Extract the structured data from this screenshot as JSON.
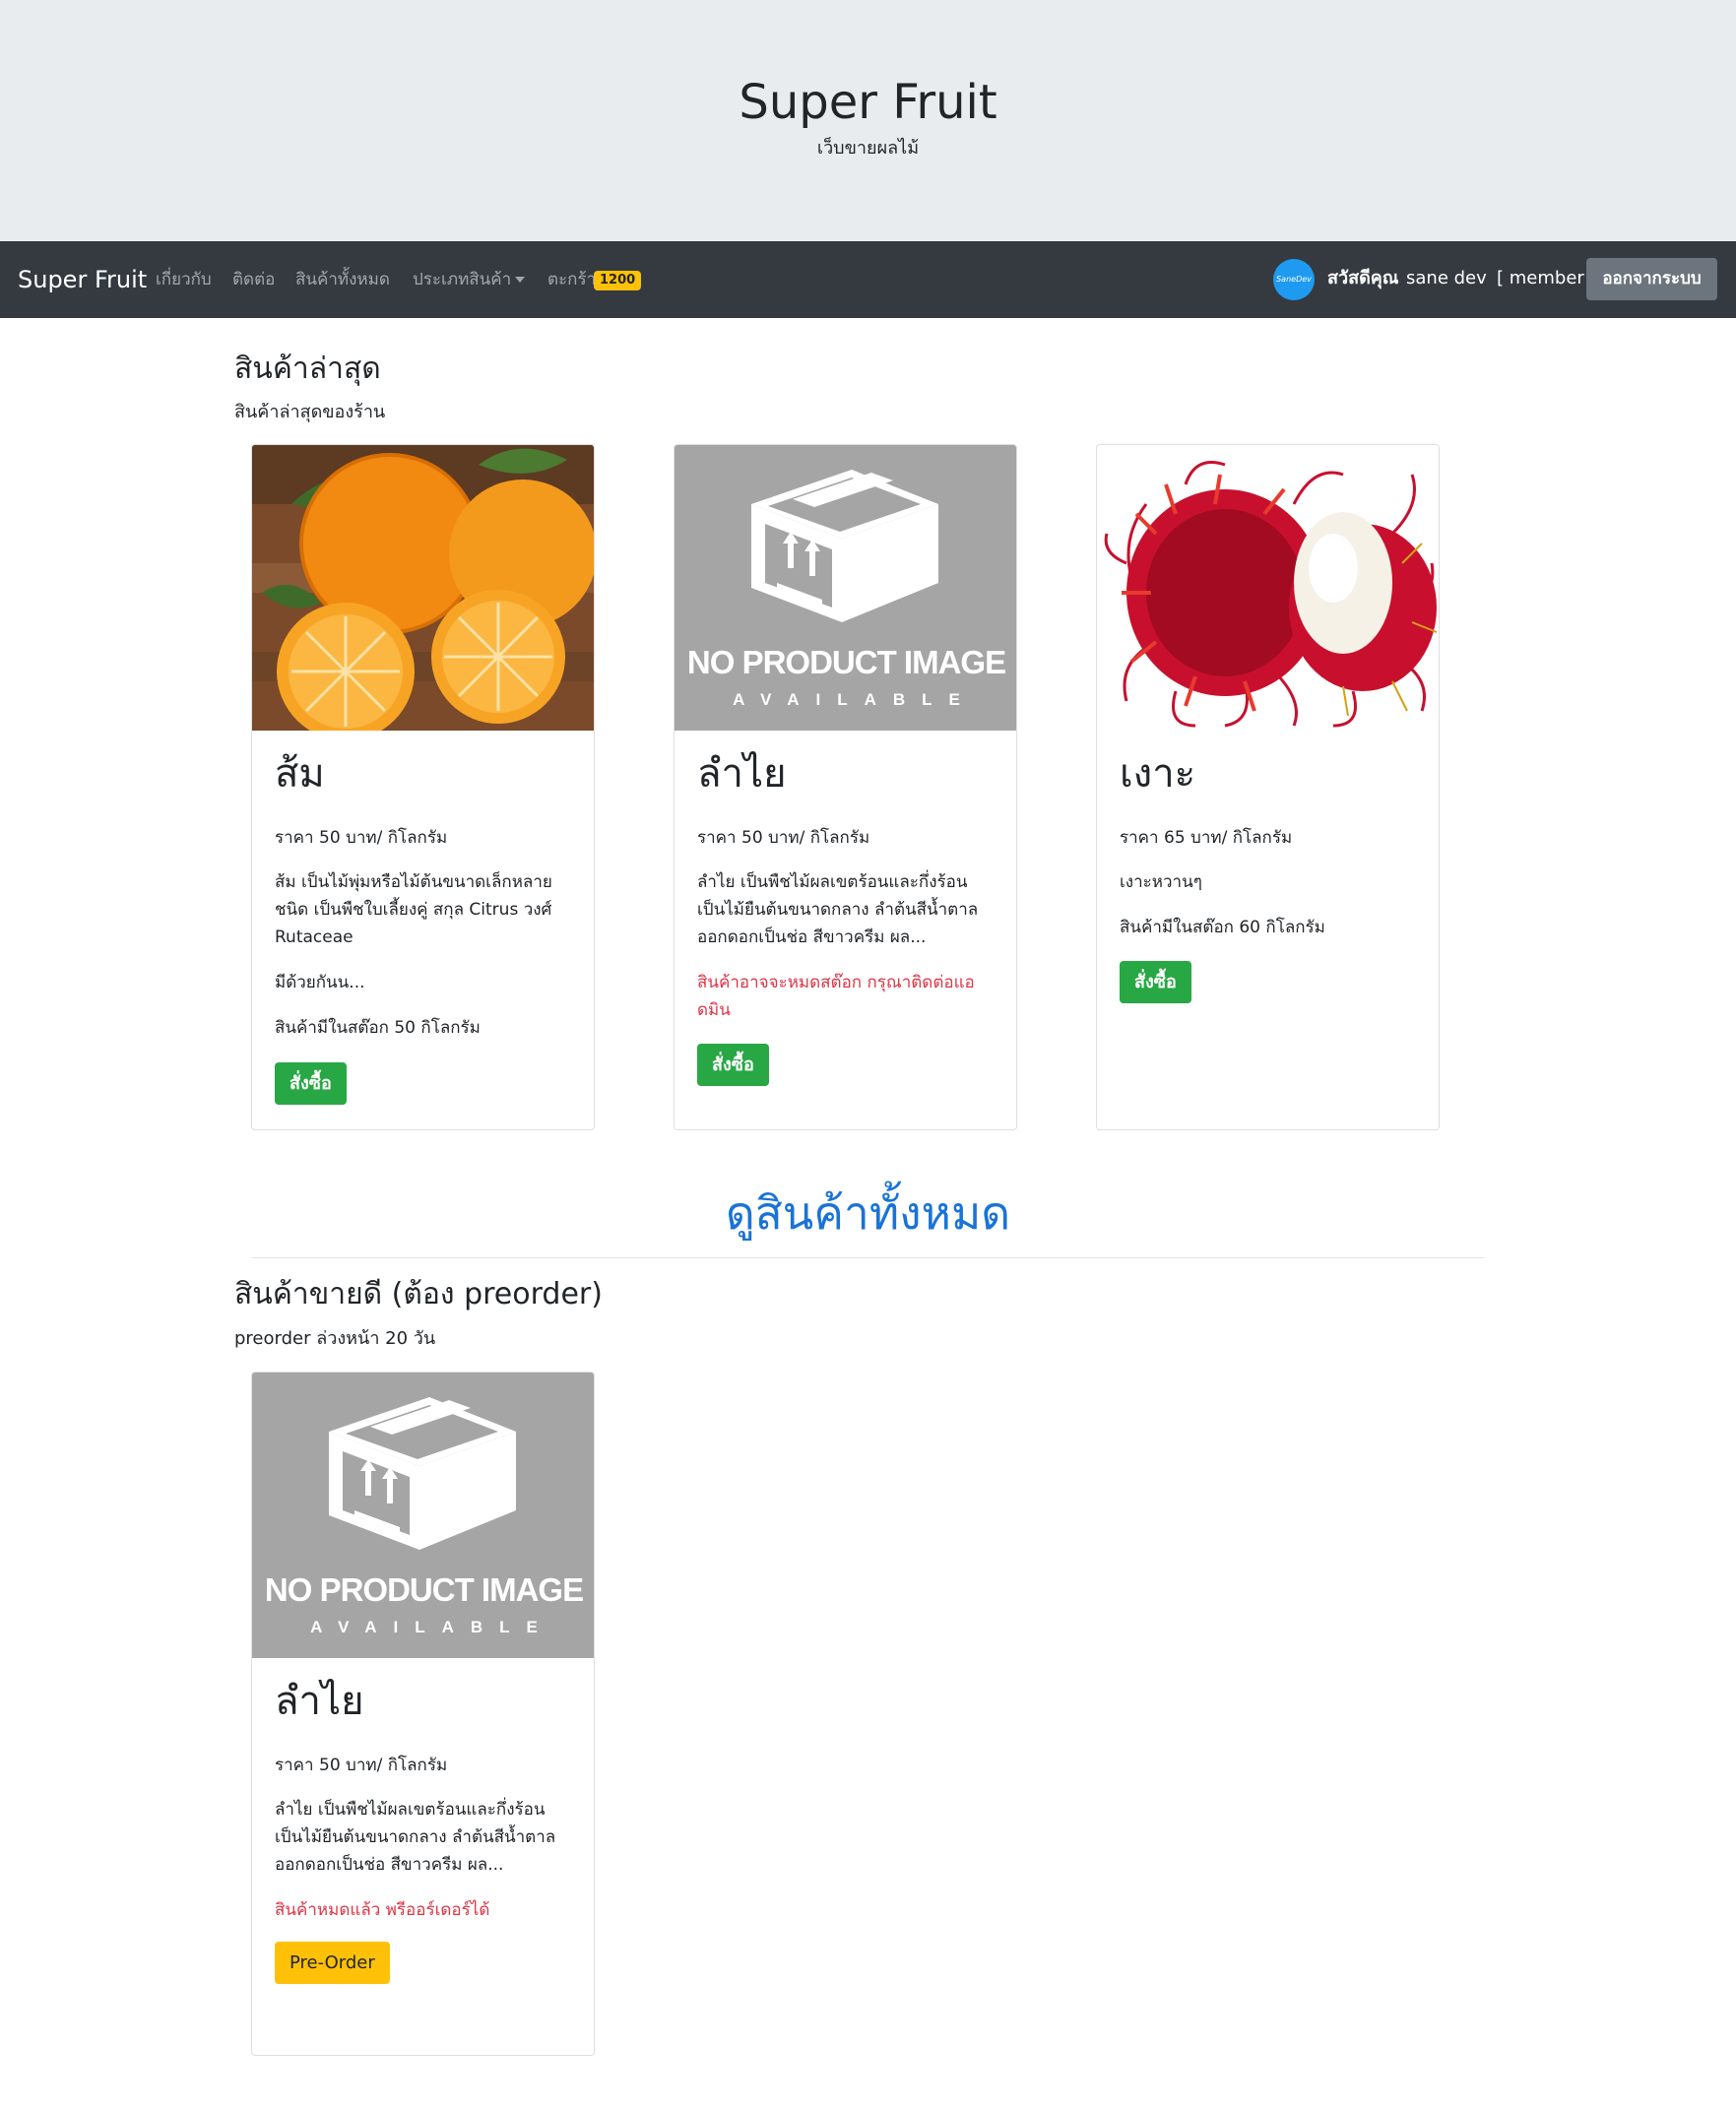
{
  "header": {
    "title": "Super Fruit",
    "subtitle": "เว็บขายผลไม้"
  },
  "navbar": {
    "brand": "Super Fruit",
    "links": [
      "เกี่ยวกับ",
      "ติดต่อ",
      "สินค้าทั้งหมด",
      "ประเภทสินค้า",
      "ตะกร้า"
    ],
    "cart_badge": "1200",
    "avatar_text": "SaneDev",
    "greeting": "สวัสดีคุณ",
    "username": "sane dev",
    "role": "[ member ]",
    "logout_label": "ออกจากระบบ"
  },
  "latest": {
    "title": "สินค้าล่าสุด",
    "subtitle": "สินค้าล่าสุดของร้าน",
    "cards": [
      {
        "name": "ส้ม",
        "price": "ราคา 50 บาท/ กิโลกรัม",
        "desc": "ส้ม เป็นไม้พุ่มหรือไม้ต้นขนาดเล็กหลายชนิด เป็นพืชใบเลี้ยงคู่ สกุล Citrus วงศ์ Rutaceae",
        "desc2": "มีด้วยกันน...",
        "stock": "สินค้ามีในสต๊อก 50 กิโลกรัม",
        "button": "สั่งซื้อ",
        "image": "orange-photo"
      },
      {
        "name": "ลำไย",
        "price": "ราคา 50 บาท/ กิโลกรัม",
        "desc": "ลำไย เป็นพืชไม้ผลเขตร้อนและกึ่งร้อน เป็นไม้ยืนต้นขนาดกลาง ลำต้นสีน้ำตาล ออกดอกเป็นช่อ สีขาวครีม ผล...",
        "warning": "สินค้าอาจจะหมดสต๊อก กรุณาติดต่อแอดมิน",
        "button": "สั่งซื้อ",
        "image": "no-product-image",
        "noimg_line1": "NO PRODUCT IMAGE",
        "noimg_line2": "AVAILABLE"
      },
      {
        "name": "เงาะ",
        "price": "ราคา 65 บาท/ กิโลกรัม",
        "desc": "เงาะหวานๆ",
        "stock": "สินค้ามีในสต๊อก 60 กิโลกรัม",
        "button": "สั่งซื้อ",
        "image": "rambutan-photo"
      }
    ]
  },
  "view_all": "ดูสินค้าทั้งหมด",
  "bestseller": {
    "title": "สินค้าขายดี (ต้อง preorder)",
    "subtitle": "preorder ล่วงหน้า 20 วัน",
    "cards": [
      {
        "name": "ลำไย",
        "price": "ราคา 50 บาท/ กิโลกรัม",
        "desc": "ลำไย เป็นพืชไม้ผลเขตร้อนและกึ่งร้อน เป็นไม้ยืนต้นขนาดกลาง ลำต้นสีน้ำตาล ออกดอกเป็นช่อ สีขาวครีม ผล...",
        "warning": "สินค้าหมดแล้ว พรีออร์เดอร์ได้",
        "button": "Pre-Order",
        "image": "no-product-image",
        "noimg_line1": "NO PRODUCT IMAGE",
        "noimg_line2": "AVAILABLE"
      }
    ]
  },
  "colors": {
    "jumbotron": "#e9ecef",
    "navbar": "#343a40",
    "success": "#28a745",
    "warning": "#ffc107",
    "danger": "#dc3545",
    "link": "#1a73d6"
  }
}
